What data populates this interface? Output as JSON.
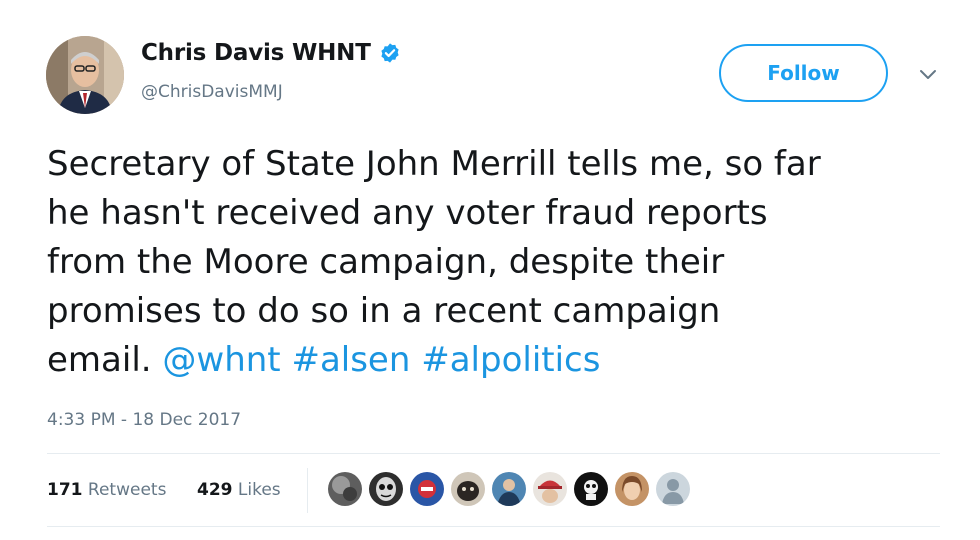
{
  "author": {
    "display_name": "Chris Davis WHNT",
    "handle": "@ChrisDavisMMJ",
    "verified": true,
    "avatar_icon": "profile-photo"
  },
  "follow_button": {
    "label": "Follow"
  },
  "menu_icon": "chevron-down-icon",
  "tweet": {
    "lines": [
      "Secretary of State John Merrill tells me, so far",
      "he hasn't received any voter fraud reports",
      "from the Moore campaign, despite their",
      "promises to do so in a recent campaign"
    ],
    "last_line_text": "email. ",
    "mention": "@whnt",
    "hashtags": [
      "#alsen",
      "#alpolitics"
    ],
    "link_color": "#1b95e0"
  },
  "timestamp": "4:33 PM - 18 Dec 2017",
  "stats": {
    "retweets_count": "171",
    "retweets_label": " Retweets",
    "likes_count": "429",
    "likes_label": " Likes"
  },
  "likers": [
    {
      "icon": "avatar-gray-circle",
      "color": "#6d6d6d"
    },
    {
      "icon": "avatar-cartoon-face",
      "color": "#3a3a3a"
    },
    {
      "icon": "avatar-blue-red-logo",
      "color": "#2b5cae"
    },
    {
      "icon": "avatar-dark-animal",
      "color": "#2f2a26"
    },
    {
      "icon": "avatar-blue-photo",
      "color": "#3f6f95"
    },
    {
      "icon": "avatar-red-cap",
      "color": "#c8343a"
    },
    {
      "icon": "avatar-black-white-logo",
      "color": "#111111"
    },
    {
      "icon": "avatar-woman-photo",
      "color": "#b07a4f"
    },
    {
      "icon": "avatar-default-egg",
      "color": "#ccd6dd"
    }
  ]
}
